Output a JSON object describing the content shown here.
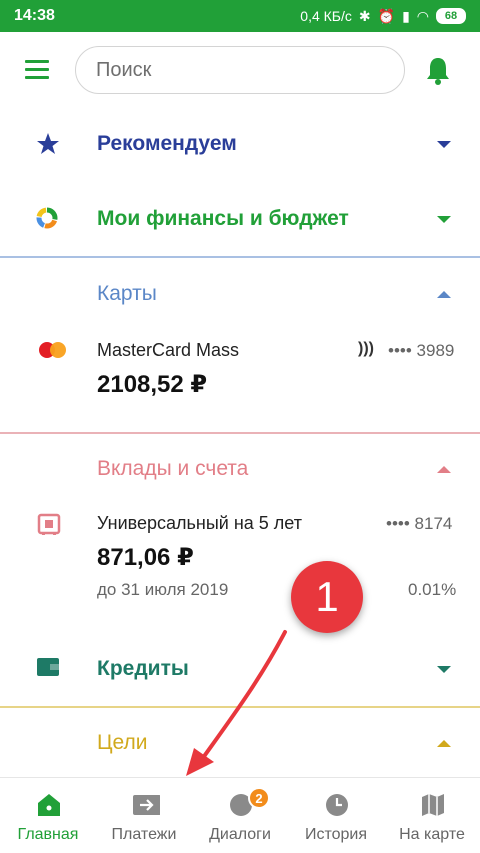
{
  "status_bar": {
    "time": "14:38",
    "speed": "0,4 КБ/с",
    "battery": "68"
  },
  "header": {
    "search_placeholder": "Поиск"
  },
  "sections": {
    "recommend": {
      "title": "Рекомендуем",
      "color": "#2a3e99"
    },
    "finance": {
      "title": "Мои финансы и бюджет",
      "color": "#21a038"
    },
    "cards": {
      "title": "Карты",
      "color": "#5b87c7",
      "card": {
        "name": "MasterCard Mass",
        "amount": "2108,52 ₽",
        "number": "•••• 3989"
      }
    },
    "deposits": {
      "title": "Вклады и счета",
      "color": "#e27e87",
      "deposit": {
        "name": "Универсальный на 5 лет",
        "amount": "871,06 ₽",
        "number": "•••• 8174",
        "until": "до 31 июля 2019",
        "rate": "0.01%"
      }
    },
    "credits": {
      "title": "Кредиты",
      "color": "#1e7a66"
    },
    "goals": {
      "title": "Цели",
      "color": "#d1a91c"
    }
  },
  "annotation": {
    "number": "1",
    "color": "#e8373d"
  },
  "bottom_nav": {
    "items": [
      {
        "label": "Главная",
        "icon": "home-icon"
      },
      {
        "label": "Платежи",
        "icon": "payments-icon"
      },
      {
        "label": "Диалоги",
        "icon": "dialogs-icon",
        "badge": "2"
      },
      {
        "label": "История",
        "icon": "history-icon"
      },
      {
        "label": "На карте",
        "icon": "map-icon"
      }
    ]
  },
  "colors": {
    "accent": "#21a038"
  }
}
